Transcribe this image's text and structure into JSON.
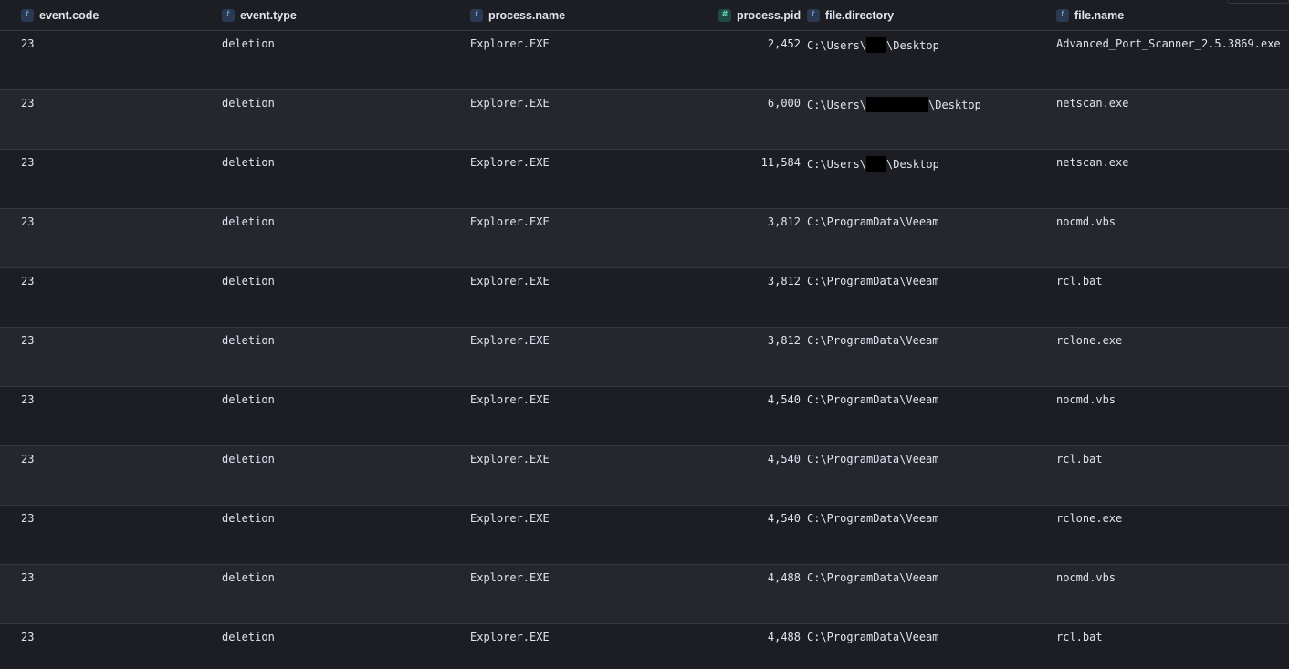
{
  "columns": [
    {
      "key": "event_code",
      "label": "event.code",
      "type": "text",
      "icon": "t"
    },
    {
      "key": "event_type",
      "label": "event.type",
      "type": "text",
      "icon": "t"
    },
    {
      "key": "process_name",
      "label": "process.name",
      "type": "text",
      "icon": "t"
    },
    {
      "key": "process_pid",
      "label": "process.pid",
      "type": "number",
      "icon": "#"
    },
    {
      "key": "file_directory",
      "label": "file.directory",
      "type": "text",
      "icon": "t"
    },
    {
      "key": "file_name",
      "label": "file.name",
      "type": "text",
      "icon": "t"
    }
  ],
  "rows": [
    {
      "event_code": "23",
      "event_type": "deletion",
      "process_name": "Explorer.EXE",
      "process_pid": "2,452",
      "dir_prefix": "C:\\Users\\",
      "dir_suffix": "\\Desktop",
      "redacted": true,
      "file_name": "Advanced_Port_Scanner_2.5.3869.exe"
    },
    {
      "event_code": "23",
      "event_type": "deletion",
      "process_name": "Explorer.EXE",
      "process_pid": "6,000",
      "dir_prefix": "C:\\Users\\",
      "dir_suffix": "\\Desktop",
      "redacted": true,
      "file_name": "netscan.exe"
    },
    {
      "event_code": "23",
      "event_type": "deletion",
      "process_name": "Explorer.EXE",
      "process_pid": "11,584",
      "dir_prefix": "C:\\Users\\",
      "dir_suffix": "\\Desktop",
      "redacted": true,
      "file_name": "netscan.exe"
    },
    {
      "event_code": "23",
      "event_type": "deletion",
      "process_name": "Explorer.EXE",
      "process_pid": "3,812",
      "dir_prefix": "C:\\ProgramData\\Veeam",
      "dir_suffix": "",
      "redacted": false,
      "file_name": "nocmd.vbs"
    },
    {
      "event_code": "23",
      "event_type": "deletion",
      "process_name": "Explorer.EXE",
      "process_pid": "3,812",
      "dir_prefix": "C:\\ProgramData\\Veeam",
      "dir_suffix": "",
      "redacted": false,
      "file_name": "rcl.bat"
    },
    {
      "event_code": "23",
      "event_type": "deletion",
      "process_name": "Explorer.EXE",
      "process_pid": "3,812",
      "dir_prefix": "C:\\ProgramData\\Veeam",
      "dir_suffix": "",
      "redacted": false,
      "file_name": "rclone.exe"
    },
    {
      "event_code": "23",
      "event_type": "deletion",
      "process_name": "Explorer.EXE",
      "process_pid": "4,540",
      "dir_prefix": "C:\\ProgramData\\Veeam",
      "dir_suffix": "",
      "redacted": false,
      "file_name": "nocmd.vbs"
    },
    {
      "event_code": "23",
      "event_type": "deletion",
      "process_name": "Explorer.EXE",
      "process_pid": "4,540",
      "dir_prefix": "C:\\ProgramData\\Veeam",
      "dir_suffix": "",
      "redacted": false,
      "file_name": "rcl.bat"
    },
    {
      "event_code": "23",
      "event_type": "deletion",
      "process_name": "Explorer.EXE",
      "process_pid": "4,540",
      "dir_prefix": "C:\\ProgramData\\Veeam",
      "dir_suffix": "",
      "redacted": false,
      "file_name": "rclone.exe"
    },
    {
      "event_code": "23",
      "event_type": "deletion",
      "process_name": "Explorer.EXE",
      "process_pid": "4,488",
      "dir_prefix": "C:\\ProgramData\\Veeam",
      "dir_suffix": "",
      "redacted": false,
      "file_name": "nocmd.vbs"
    },
    {
      "event_code": "23",
      "event_type": "deletion",
      "process_name": "Explorer.EXE",
      "process_pid": "4,488",
      "dir_prefix": "C:\\ProgramData\\Veeam",
      "dir_suffix": "",
      "redacted": false,
      "file_name": "rcl.bat"
    }
  ]
}
